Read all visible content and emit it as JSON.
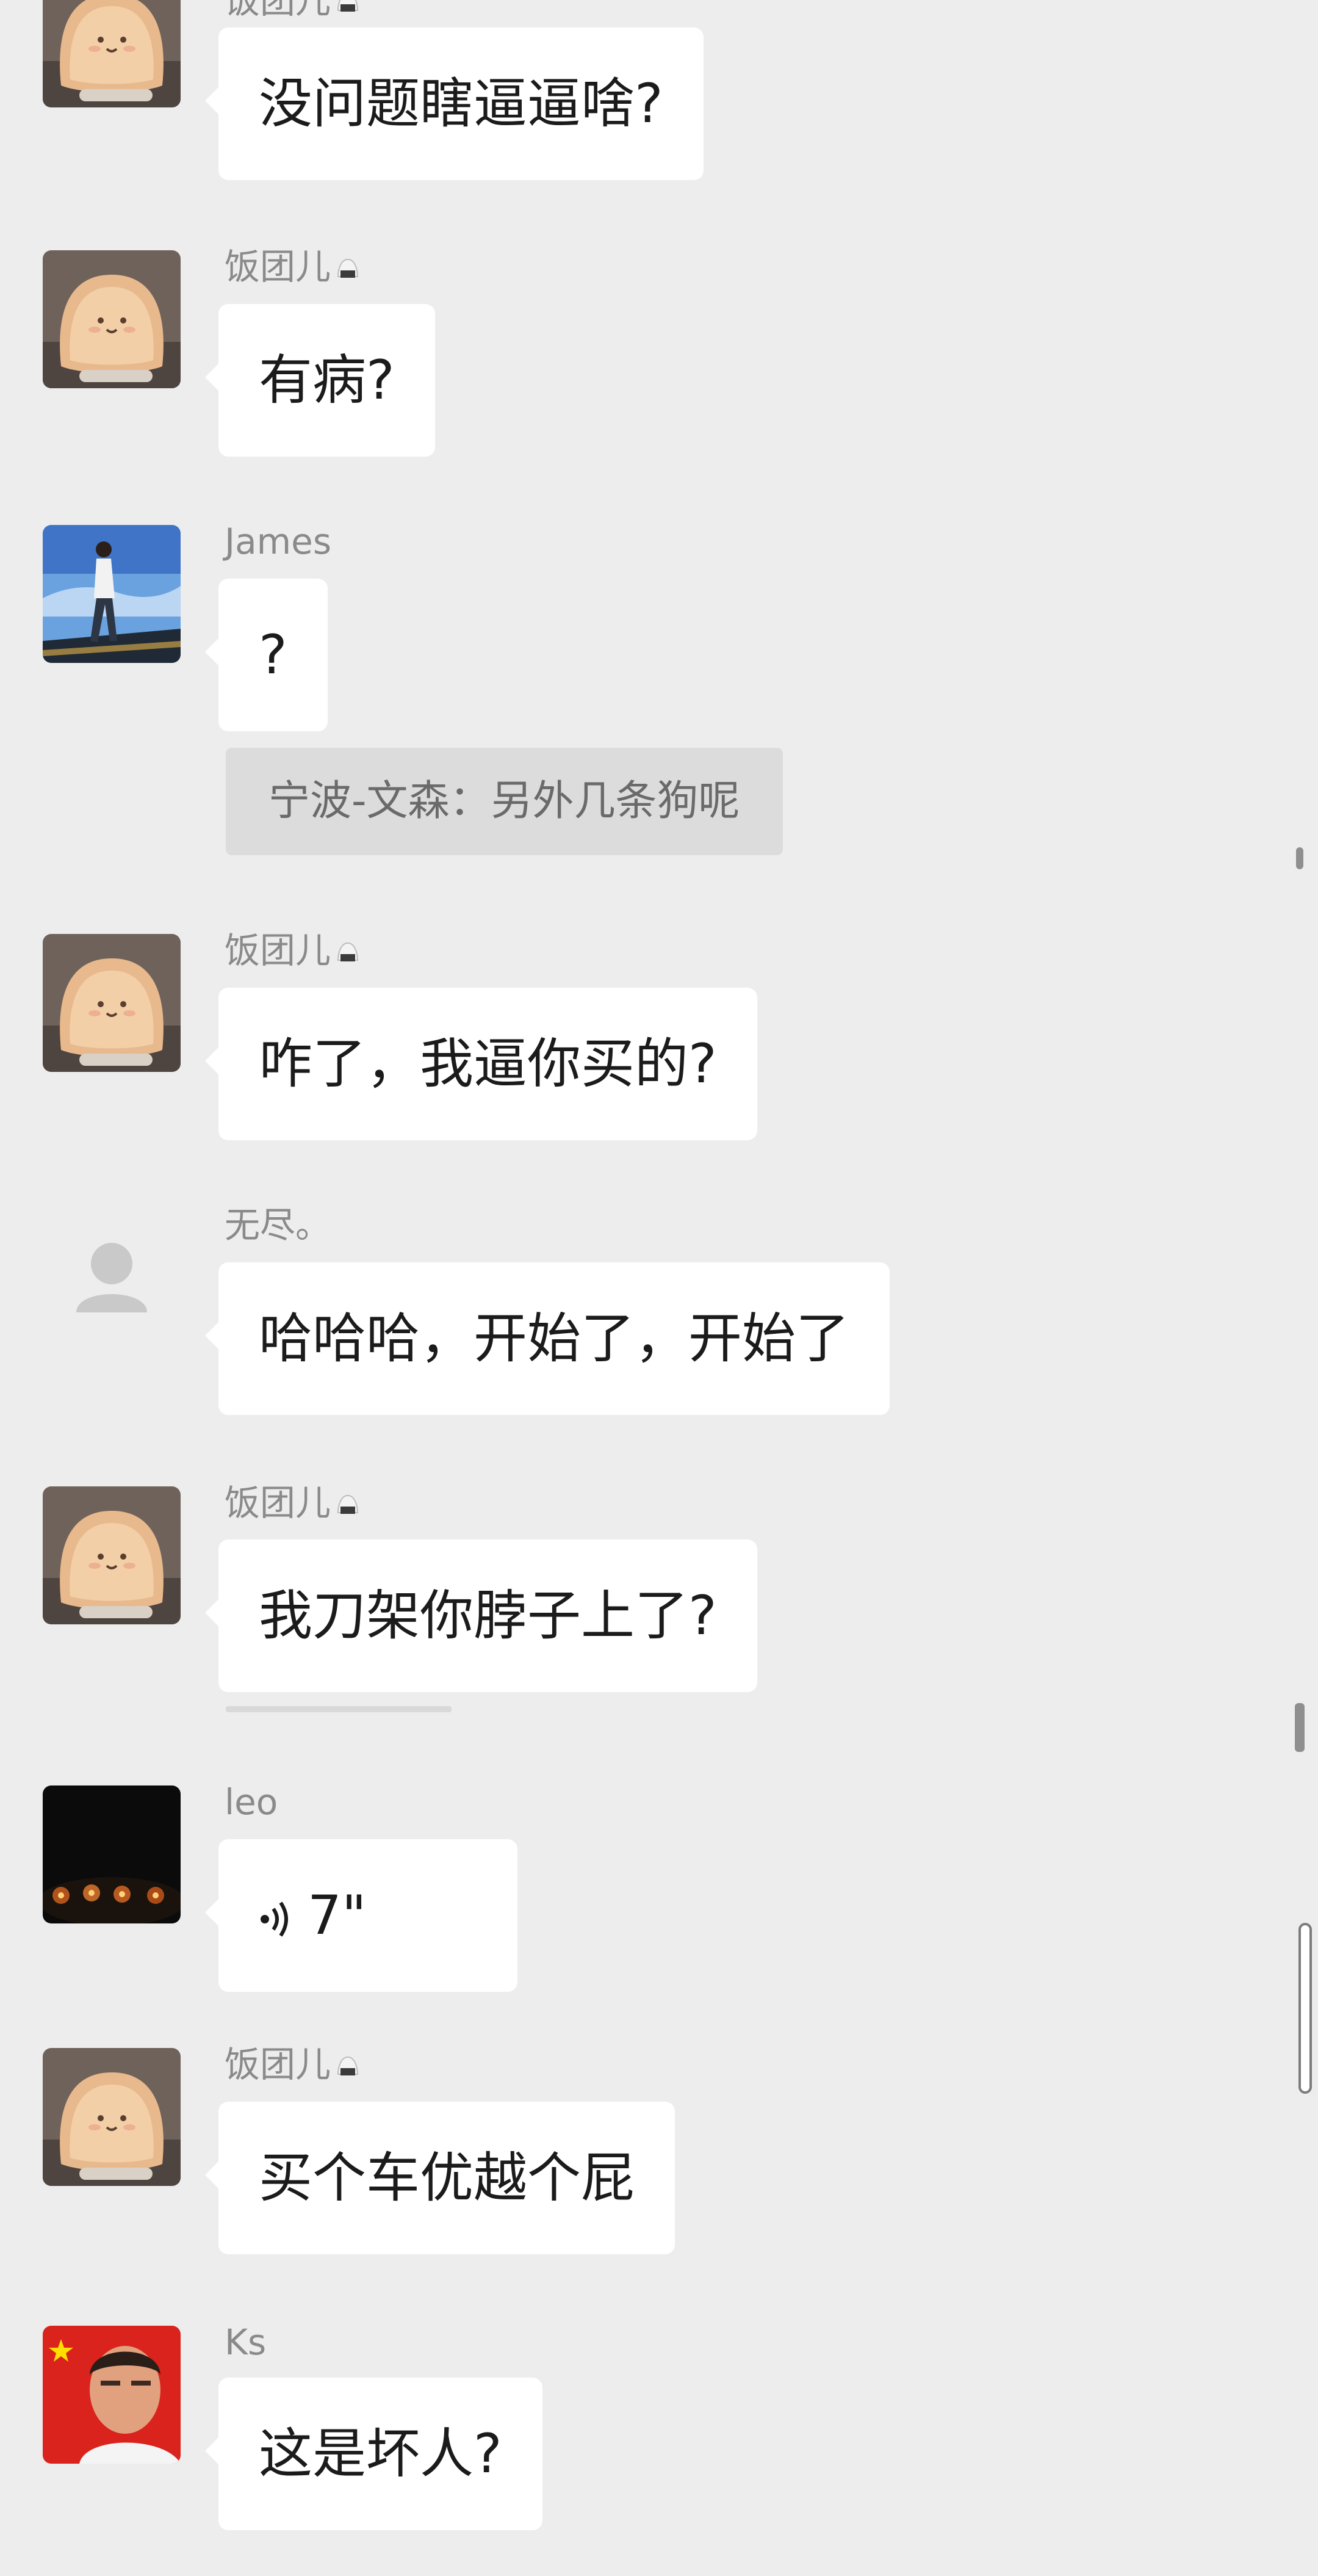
{
  "chat": {
    "messages": [
      {
        "sender": "饭团儿",
        "text": "没问题瞎逼逼啥?"
      },
      {
        "sender": "饭团儿",
        "text": "有病?"
      },
      {
        "sender": "James",
        "text": "?",
        "quote": "宁波-文森：另外几条狗呢"
      },
      {
        "sender": "饭团儿",
        "text": "咋了，我逼你买的?"
      },
      {
        "sender": "无尽。",
        "text": "哈哈哈，开始了，开始了"
      },
      {
        "sender": "饭团儿",
        "text": "我刀架你脖子上了?"
      },
      {
        "sender": "leo",
        "voice_duration": "7\""
      },
      {
        "sender": "饭团儿",
        "text": "买个车优越个屁"
      },
      {
        "sender": "Ks",
        "text": "这是坏人?"
      }
    ]
  },
  "icons": {
    "avatar_fantuaner": "toast-bread-avatar-icon",
    "avatar_james": "person-walking-avatar-icon",
    "avatar_wujin": "default-user-avatar-icon",
    "avatar_leo": "dark-candles-avatar-icon",
    "avatar_ks": "flag-portrait-avatar-icon",
    "voice": "voice-wave-icon",
    "sender_badge": "rice-ball-badge-icon"
  },
  "colors": {
    "background": "#ededed",
    "bubble": "#ffffff",
    "quote_background": "#dcdcdc",
    "sender_name": "#8a8a8a",
    "message_text": "#1b1b1b"
  }
}
